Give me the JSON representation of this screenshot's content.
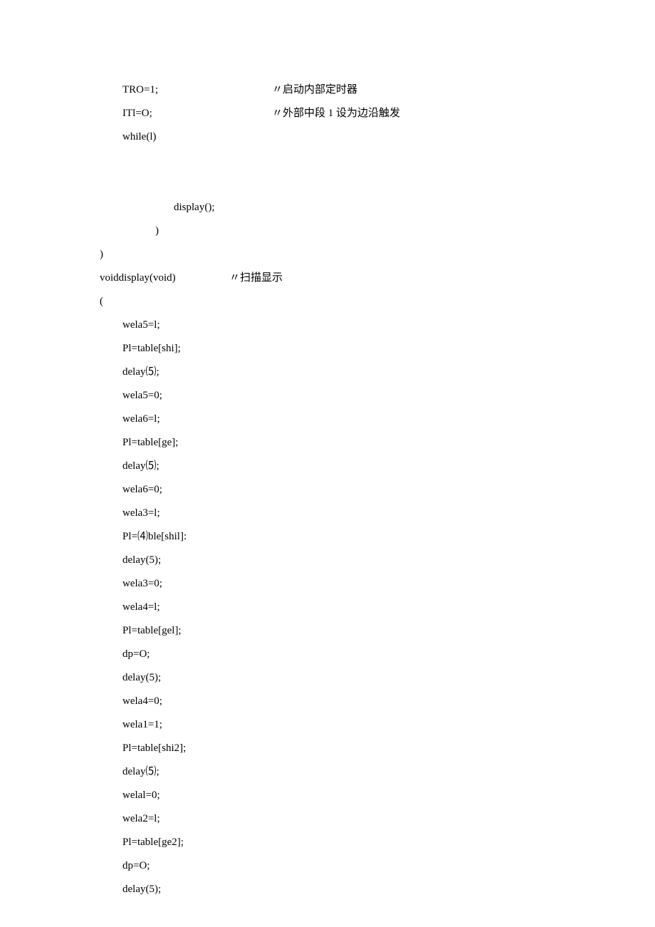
{
  "lines": [
    {
      "indent": "indent1",
      "code": "TRO=1;",
      "comment": "〃启动内部定时器",
      "cw": "w180"
    },
    {
      "indent": "indent1",
      "code": "ITl=O;",
      "comment": "〃外部中段 1 设为边沿触发",
      "cw": "w180"
    },
    {
      "indent": "indent1",
      "code": "while(l)"
    },
    {
      "gap": true
    },
    {
      "indent": "indent3",
      "code": "display();"
    },
    {
      "indent": "indent2b",
      "code": ")"
    },
    {
      "indent": "indent0",
      "code": ")"
    },
    {
      "indent": "indent0",
      "code": "voiddisplay(void)",
      "comment": "〃扫描显示",
      "cw": "w150"
    },
    {
      "indent": "indent0",
      "code": "("
    },
    {
      "indent": "indent1",
      "code": "wela5=l;"
    },
    {
      "indent": "indent1",
      "code": "Pl=table[shi];"
    },
    {
      "indent": "indent1",
      "code": "delay⑸;"
    },
    {
      "indent": "indent1",
      "code": "wela5=0;"
    },
    {
      "indent": "indent1",
      "code": "wela6=l;"
    },
    {
      "indent": "indent1",
      "code": "Pl=table[ge];"
    },
    {
      "indent": "indent1",
      "code": "delay⑸;"
    },
    {
      "indent": "indent1",
      "code": "wela6=0;"
    },
    {
      "indent": "indent1",
      "code": "wela3=l;"
    },
    {
      "indent": "indent1",
      "code": "Pl=⑷ble[shil]:"
    },
    {
      "indent": "indent1",
      "code": "delay(5);"
    },
    {
      "indent": "indent1",
      "code": "wela3=0;"
    },
    {
      "indent": "indent1",
      "code": "wela4=l;"
    },
    {
      "indent": "indent1",
      "code": "Pl=table[gel];"
    },
    {
      "indent": "indent1",
      "code": "dp=O;"
    },
    {
      "indent": "indent1",
      "code": "delay(5);"
    },
    {
      "indent": "indent1",
      "code": "wela4=0;"
    },
    {
      "indent": "indent1",
      "code": "wela1=1;"
    },
    {
      "indent": "indent1",
      "code": "Pl=table[shi2];"
    },
    {
      "indent": "indent1",
      "code": "delay⑸;"
    },
    {
      "indent": "indent1",
      "code": "welal=0;"
    },
    {
      "indent": "indent1",
      "code": "wela2=l;"
    },
    {
      "indent": "indent1",
      "code": "Pl=table[ge2];"
    },
    {
      "indent": "indent1",
      "code": "dp=O;"
    },
    {
      "indent": "indent1",
      "code": "delay(5);"
    }
  ]
}
